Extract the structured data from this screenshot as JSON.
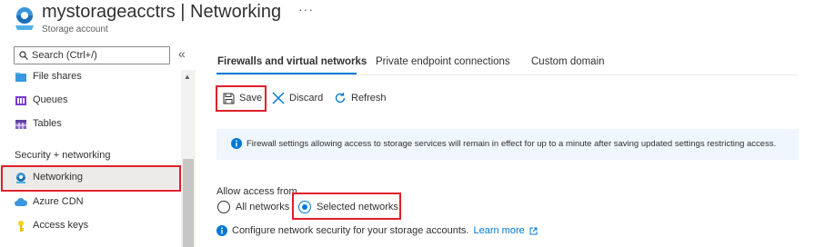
{
  "header": {
    "resource_name": "mystorageacctrs",
    "separator": "|",
    "blade_name": "Networking",
    "more_label": "···",
    "resource_type": "Storage account"
  },
  "sidebar": {
    "search_placeholder": "Search (Ctrl+/)",
    "collapse_label": "«",
    "items_top": [
      {
        "label": "File shares",
        "icon": "file-shares-icon"
      },
      {
        "label": "Queues",
        "icon": "queues-icon"
      },
      {
        "label": "Tables",
        "icon": "tables-icon"
      }
    ],
    "section_label": "Security + networking",
    "items_bottom": [
      {
        "label": "Networking",
        "icon": "networking-icon",
        "selected": true
      },
      {
        "label": "Azure CDN",
        "icon": "cdn-icon"
      },
      {
        "label": "Access keys",
        "icon": "key-icon"
      }
    ]
  },
  "tabs": [
    {
      "label": "Firewalls and virtual networks",
      "active": true
    },
    {
      "label": "Private endpoint connections",
      "active": false
    },
    {
      "label": "Custom domain",
      "active": false
    }
  ],
  "toolbar": {
    "save_label": "Save",
    "discard_label": "Discard",
    "refresh_label": "Refresh"
  },
  "info_message": "Firewall settings allowing access to storage services will remain in effect for up to a minute after saving updated settings restricting access.",
  "access": {
    "label": "Allow access from",
    "options": [
      {
        "label": "All networks",
        "selected": false
      },
      {
        "label": "Selected networks",
        "selected": true
      }
    ]
  },
  "config": {
    "text": "Configure network security for your storage accounts.",
    "link_label": "Learn more"
  },
  "colors": {
    "accent": "#0078d4",
    "highlight_border": "#e01f2a",
    "info_background": "#f0f6fd",
    "selected_nav_background": "#edebe9"
  }
}
